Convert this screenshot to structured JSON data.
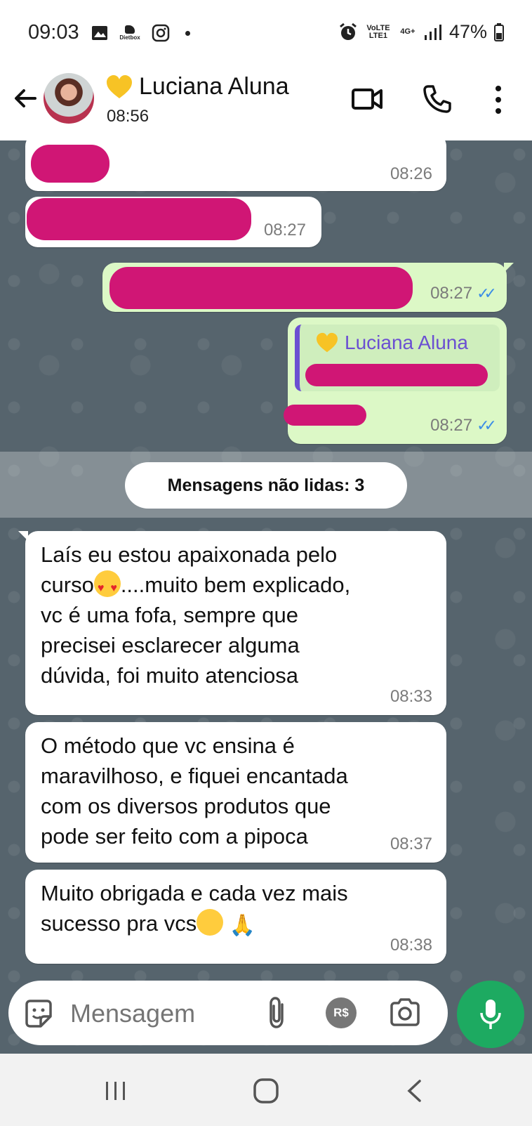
{
  "status_bar": {
    "time": "09:03",
    "app_badge": "Dietbox",
    "network": "4G+",
    "carrier": "VoLTE LTE1",
    "battery": "47%"
  },
  "header": {
    "name": "Luciana Aluna",
    "name_emoji": "yellow-heart",
    "last_seen": "08:56"
  },
  "messages": [
    {
      "direction": "in",
      "time": "08:26",
      "redacted": true
    },
    {
      "direction": "in",
      "time": "08:27",
      "redacted": true
    },
    {
      "direction": "out",
      "time": "08:27",
      "redacted": true,
      "status": "read"
    },
    {
      "direction": "out",
      "time": "08:27",
      "redacted": true,
      "status": "read",
      "quote_name": "Luciana Aluna"
    }
  ],
  "unread_label": "Mensagens não lidas: 3",
  "unread_messages": [
    {
      "line1": "Laís eu estou apaixonada pelo",
      "line2a": "curso",
      "line2b": "....muito bem explicado,",
      "line3": "vc é uma fofa, sempre que",
      "line4": "precisei esclarecer alguma",
      "line5": "dúvida,  foi muito atenciosa",
      "time": "08:33"
    },
    {
      "text": "O método que vc ensina é\nmaravilhoso, e fiquei encantada\ncom os diversos produtos que\npode ser feito com a pipoca",
      "time": "08:37"
    },
    {
      "line1": "Muito obrigada e cada vez mais",
      "line2": "sucesso pra vcs",
      "time": "08:38"
    }
  ],
  "composer": {
    "placeholder": "Mensagem"
  },
  "colors": {
    "accent": "#1daa61",
    "outgoing": "#dcf8c6",
    "read_ticks": "#3b8de6",
    "quote_bar": "#6b4fd2",
    "redaction": "#d01675"
  }
}
